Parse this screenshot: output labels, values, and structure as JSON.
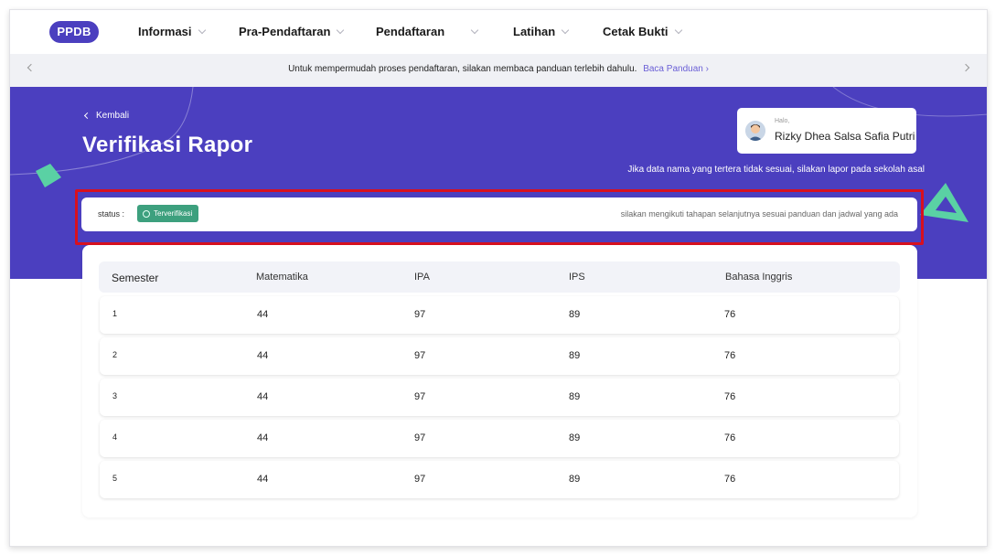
{
  "nav": {
    "logo": "PPDB",
    "items": [
      {
        "label": "Informasi"
      },
      {
        "label": "Pra-Pendaftaran"
      },
      {
        "label": "Pendaftaran"
      },
      {
        "label": "Latihan"
      },
      {
        "label": "Cetak Bukti"
      }
    ]
  },
  "announcement": {
    "text": "Untuk mempermudah proses pendaftaran, silakan membaca panduan terlebih dahulu.",
    "link": "Baca Panduan ›"
  },
  "hero": {
    "back_label": "Kembali",
    "title": "Verifikasi Rapor",
    "greeting": "Halo,",
    "user_name": "Rizky Dhea Salsa Safia Putri",
    "note": "Jika data nama yang tertera tidak sesuai, silakan lapor pada sekolah asal"
  },
  "status": {
    "label": "status :",
    "badge": "Terverifikasi",
    "message": "silakan mengikuti tahapan selanjutnya sesuai panduan dan jadwal yang ada"
  },
  "table": {
    "headers": [
      "Semester",
      "Matematika",
      "IPA",
      "IPS",
      "Bahasa Inggris"
    ],
    "rows": [
      [
        "1",
        "44",
        "97",
        "89",
        "76"
      ],
      [
        "2",
        "44",
        "97",
        "89",
        "76"
      ],
      [
        "3",
        "44",
        "97",
        "89",
        "76"
      ],
      [
        "4",
        "44",
        "97",
        "89",
        "76"
      ],
      [
        "5",
        "44",
        "97",
        "89",
        "76"
      ]
    ]
  },
  "colors": {
    "brand": "#4b3fbf",
    "verified": "#3da07e",
    "highlight": "#d8101e",
    "link": "#6a5fd6"
  }
}
